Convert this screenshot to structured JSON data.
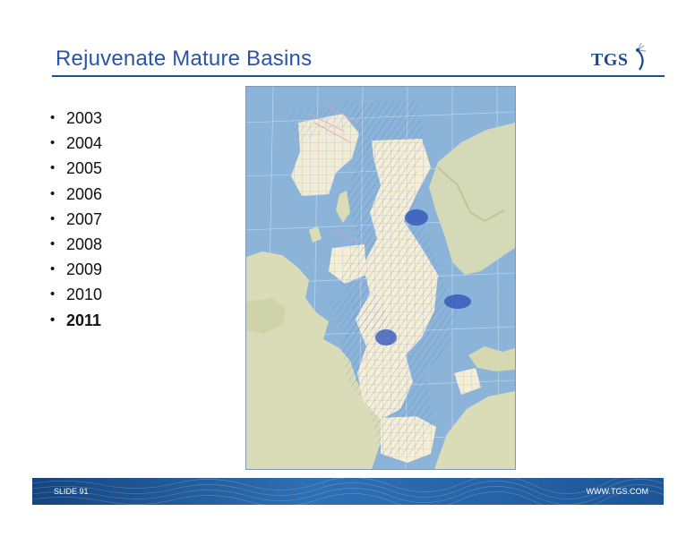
{
  "slide": {
    "title": "Rejuvenate Mature Basins",
    "logo_text": "TGS",
    "bullets": [
      "2003",
      "2004",
      "2005",
      "2006",
      "2007",
      "2008",
      "2009",
      "2010",
      "2011"
    ],
    "current_year": "2011"
  },
  "footer": {
    "slide_label": "SLIDE 91",
    "website": "WWW.TGS.COM"
  },
  "colors": {
    "title": "#2a55a6",
    "accent": "#1c4f96",
    "sea": "#8bb4d8",
    "land": "#d9dcb8",
    "survey_block": "#f6efd6",
    "survey_line": "#3b66c0"
  }
}
